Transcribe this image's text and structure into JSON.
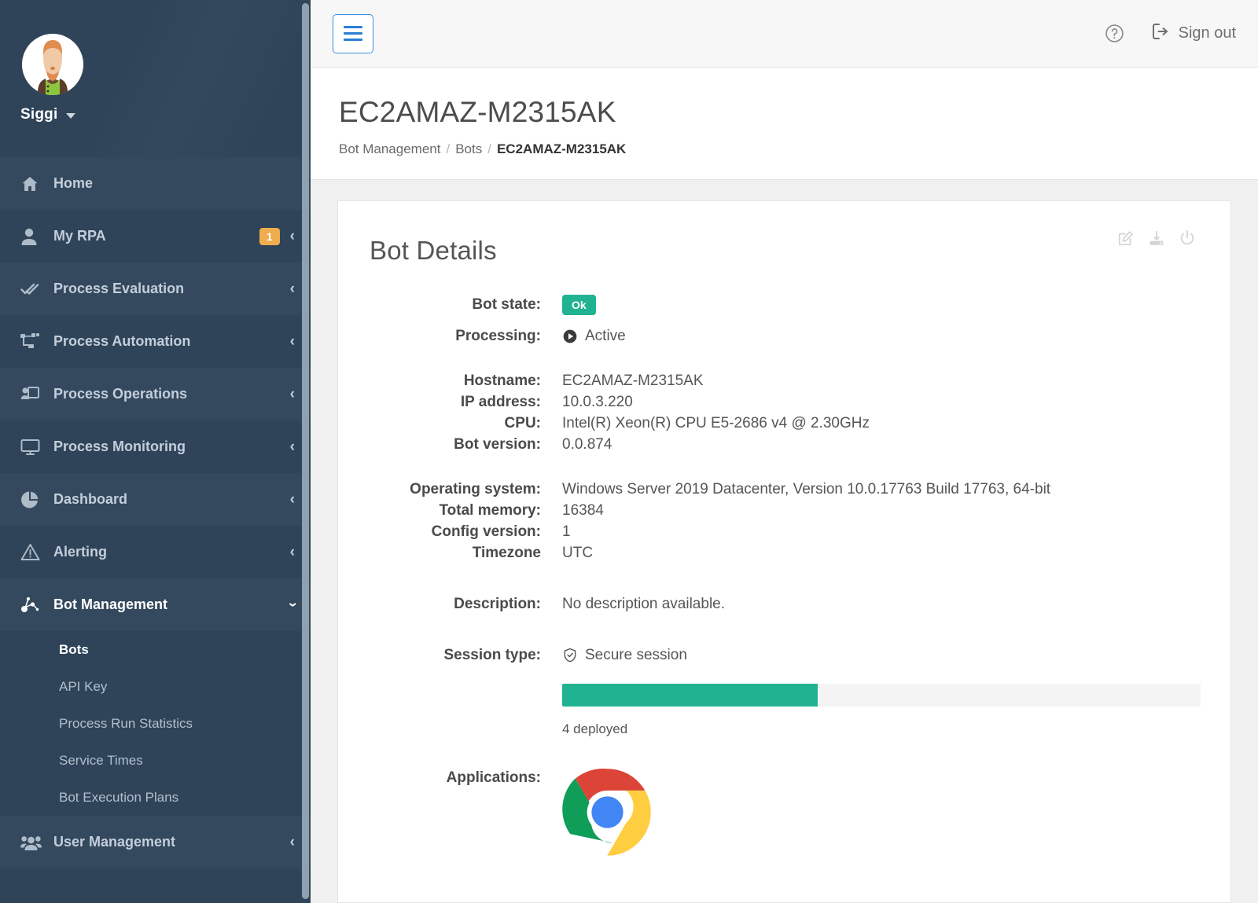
{
  "sidebar": {
    "user": {
      "name": "Siggi",
      "avatar_icon": "user-avatar",
      "caret_icon": "chevron-down-icon"
    },
    "items": [
      {
        "label": "Home",
        "icon": "home-icon",
        "badge": null,
        "chevron": null,
        "state": "light"
      },
      {
        "label": "My RPA",
        "icon": "user-icon",
        "badge": "1",
        "chevron": "chevron-left-icon",
        "state": "dark"
      },
      {
        "label": "Process Evaluation",
        "icon": "double-check-icon",
        "badge": null,
        "chevron": "chevron-left-icon",
        "state": "light"
      },
      {
        "label": "Process Automation",
        "icon": "sitemap-icon",
        "badge": null,
        "chevron": "chevron-left-icon",
        "state": "dark"
      },
      {
        "label": "Process Operations",
        "icon": "user-screen-icon",
        "badge": null,
        "chevron": "chevron-left-icon",
        "state": "light"
      },
      {
        "label": "Process Monitoring",
        "icon": "monitor-icon",
        "badge": null,
        "chevron": "chevron-left-icon",
        "state": "dark"
      },
      {
        "label": "Dashboard",
        "icon": "pie-chart-icon",
        "badge": null,
        "chevron": "chevron-left-icon",
        "state": "light"
      },
      {
        "label": "Alerting",
        "icon": "warning-triangle-icon",
        "badge": null,
        "chevron": "chevron-left-icon",
        "state": "dark"
      },
      {
        "label": "Bot Management",
        "icon": "bot-network-icon",
        "badge": null,
        "chevron": "chevron-down-icon",
        "state": "active"
      }
    ],
    "bot_management_subitems": [
      {
        "label": "Bots",
        "current": true
      },
      {
        "label": "API Key",
        "current": false
      },
      {
        "label": "Process Run Statistics",
        "current": false
      },
      {
        "label": "Service Times",
        "current": false
      },
      {
        "label": "Bot Execution Plans",
        "current": false
      }
    ],
    "footer_item": {
      "label": "User Management",
      "icon": "users-icon",
      "chevron": "chevron-left-icon"
    }
  },
  "topbar": {
    "menu_toggle_icon": "hamburger-icon",
    "help_icon": "help-circle-icon",
    "signout_icon": "sign-out-icon",
    "signout_label": "Sign out"
  },
  "page": {
    "title": "EC2AMAZ-M2315AK",
    "breadcrumb": [
      {
        "label": "Bot Management",
        "current": false
      },
      {
        "label": "Bots",
        "current": false
      },
      {
        "label": "EC2AMAZ-M2315AK",
        "current": true
      }
    ],
    "breadcrumb_separator": "/"
  },
  "card": {
    "title": "Bot Details",
    "actions": [
      {
        "name": "edit",
        "icon": "pencil-square-icon"
      },
      {
        "name": "download",
        "icon": "download-icon"
      },
      {
        "name": "power",
        "icon": "power-icon"
      }
    ],
    "bot_state": {
      "label": "Bot state:",
      "value": "Ok",
      "color": "#21b391"
    },
    "processing": {
      "label": "Processing:",
      "value": "Active",
      "icon": "play-circle-icon"
    },
    "fields": [
      {
        "label": "Hostname:",
        "value": "EC2AMAZ-M2315AK"
      },
      {
        "label": "IP address:",
        "value": "10.0.3.220"
      },
      {
        "label": "CPU:",
        "value": "Intel(R) Xeon(R) CPU E5-2686 v4 @ 2.30GHz"
      },
      {
        "label": "Bot version:",
        "value": "0.0.874"
      }
    ],
    "system_fields": [
      {
        "label": "Operating system:",
        "value": "Windows Server 2019 Datacenter, Version 10.0.17763 Build 17763, 64-bit"
      },
      {
        "label": "Total memory:",
        "value": "16384"
      },
      {
        "label": "Config version:",
        "value": "1"
      },
      {
        "label": "Timezone",
        "value": "UTC"
      }
    ],
    "description": {
      "label": "Description:",
      "value": "No description available."
    },
    "session_type": {
      "label": "Session type:",
      "value": "Secure session",
      "icon": "shield-check-icon",
      "progress_percent": 40,
      "progress_color": "#21b391",
      "deployed_text": "4 deployed"
    },
    "applications": {
      "label": "Applications:",
      "items": [
        {
          "name": "chrome",
          "icon": "chrome-logo-icon"
        }
      ]
    }
  }
}
